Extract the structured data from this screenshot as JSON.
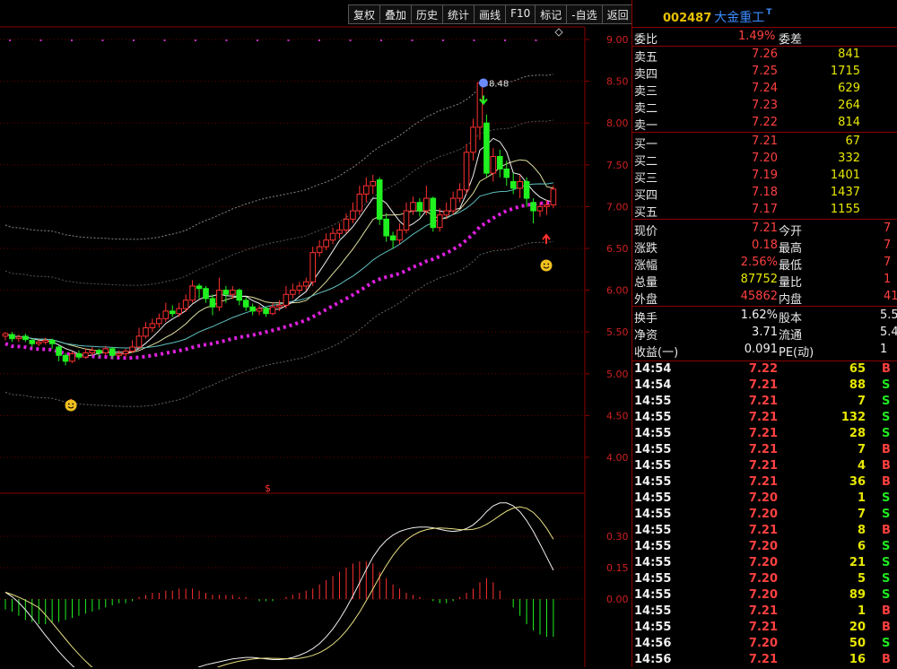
{
  "toolbar": [
    "复权",
    "叠加",
    "历史",
    "统计",
    "画线",
    "F10",
    "标记",
    "-自选",
    "返回"
  ],
  "stock": {
    "code": "002487",
    "name": "大金重工",
    "flag": "T"
  },
  "chart": {
    "price_ticks": [
      "9.00",
      "8.50",
      "8.00",
      "7.50",
      "7.00",
      "6.50",
      "6.00",
      "5.50",
      "5.00",
      "4.50",
      "4.00"
    ],
    "macd_ticks": [
      "0.30",
      "0.15",
      "0.00"
    ],
    "high_label": "8.48",
    "dollar_mark": "$"
  },
  "weibi": {
    "label": "委比",
    "value": "1.49%",
    "label2": "委差"
  },
  "asks": [
    {
      "label": "卖五",
      "price": "7.26",
      "vol": "841"
    },
    {
      "label": "卖四",
      "price": "7.25",
      "vol": "1715"
    },
    {
      "label": "卖三",
      "price": "7.24",
      "vol": "629"
    },
    {
      "label": "卖二",
      "price": "7.23",
      "vol": "264"
    },
    {
      "label": "卖一",
      "price": "7.22",
      "vol": "814"
    }
  ],
  "bids": [
    {
      "label": "买一",
      "price": "7.21",
      "vol": "67"
    },
    {
      "label": "买二",
      "price": "7.20",
      "vol": "332"
    },
    {
      "label": "买三",
      "price": "7.19",
      "vol": "1401"
    },
    {
      "label": "买四",
      "price": "7.18",
      "vol": "1437"
    },
    {
      "label": "买五",
      "price": "7.17",
      "vol": "1155"
    }
  ],
  "quote": [
    {
      "l1": "现价",
      "v1": "7.21",
      "c1": "red",
      "l2": "今开",
      "v2": "7"
    },
    {
      "l1": "涨跌",
      "v1": "0.18",
      "c1": "red",
      "l2": "最高",
      "v2": "7"
    },
    {
      "l1": "涨幅",
      "v1": "2.56%",
      "c1": "red",
      "l2": "最低",
      "v2": "7"
    },
    {
      "l1": "总量",
      "v1": "87752",
      "c1": "yel",
      "l2": "量比",
      "v2": "1"
    },
    {
      "l1": "外盘",
      "v1": "45862",
      "c1": "red",
      "l2": "内盘",
      "v2": "41"
    }
  ],
  "fin": [
    {
      "l1": "换手",
      "v1": "1.62%",
      "l2": "股本",
      "v2": "5.5"
    },
    {
      "l1": "净资",
      "v1": "3.71",
      "l2": "流通",
      "v2": "5.4"
    },
    {
      "l1": "收益(一)",
      "v1": "0.091",
      "l2": "PE(动)",
      "v2": "1"
    }
  ],
  "ticks": [
    {
      "t": "14:54",
      "p": "7.22",
      "v": "65",
      "s": "B"
    },
    {
      "t": "14:54",
      "p": "7.21",
      "v": "88",
      "s": "S"
    },
    {
      "t": "14:55",
      "p": "7.21",
      "v": "7",
      "s": "S"
    },
    {
      "t": "14:55",
      "p": "7.21",
      "v": "132",
      "s": "S"
    },
    {
      "t": "14:55",
      "p": "7.21",
      "v": "28",
      "s": "S"
    },
    {
      "t": "14:55",
      "p": "7.21",
      "v": "7",
      "s": "B"
    },
    {
      "t": "14:55",
      "p": "7.21",
      "v": "4",
      "s": "B"
    },
    {
      "t": "14:55",
      "p": "7.21",
      "v": "36",
      "s": "B"
    },
    {
      "t": "14:55",
      "p": "7.20",
      "v": "1",
      "s": "S"
    },
    {
      "t": "14:55",
      "p": "7.20",
      "v": "7",
      "s": "S"
    },
    {
      "t": "14:55",
      "p": "7.21",
      "v": "8",
      "s": "B"
    },
    {
      "t": "14:55",
      "p": "7.20",
      "v": "6",
      "s": "S"
    },
    {
      "t": "14:55",
      "p": "7.20",
      "v": "21",
      "s": "S"
    },
    {
      "t": "14:55",
      "p": "7.20",
      "v": "5",
      "s": "S"
    },
    {
      "t": "14:55",
      "p": "7.20",
      "v": "89",
      "s": "S"
    },
    {
      "t": "14:55",
      "p": "7.21",
      "v": "1",
      "s": "B"
    },
    {
      "t": "14:55",
      "p": "7.21",
      "v": "20",
      "s": "B"
    },
    {
      "t": "14:56",
      "p": "7.20",
      "v": "50",
      "s": "S"
    },
    {
      "t": "14:56",
      "p": "7.21",
      "v": "16",
      "s": "B"
    }
  ],
  "chart_data": {
    "type": "candlestick",
    "y_range": [
      3.6,
      9.2
    ],
    "candles": [
      [
        5.45,
        5.48,
        5.4,
        5.5
      ],
      [
        5.47,
        5.42,
        5.38,
        5.5
      ],
      [
        5.42,
        5.44,
        5.38,
        5.47
      ],
      [
        5.45,
        5.41,
        5.38,
        5.48
      ],
      [
        5.4,
        5.36,
        5.32,
        5.42
      ],
      [
        5.36,
        5.38,
        5.33,
        5.41
      ],
      [
        5.38,
        5.4,
        5.35,
        5.43
      ],
      [
        5.4,
        5.36,
        5.3,
        5.42
      ],
      [
        5.32,
        5.22,
        5.15,
        5.34
      ],
      [
        5.22,
        5.15,
        5.1,
        5.25
      ],
      [
        5.15,
        5.24,
        5.13,
        5.27
      ],
      [
        5.24,
        5.2,
        5.17,
        5.28
      ],
      [
        5.2,
        5.25,
        5.18,
        5.3
      ],
      [
        5.25,
        5.28,
        5.22,
        5.32
      ],
      [
        5.28,
        5.25,
        5.2,
        5.3
      ],
      [
        5.25,
        5.3,
        5.22,
        5.33
      ],
      [
        5.3,
        5.22,
        5.18,
        5.32
      ],
      [
        5.22,
        5.24,
        5.2,
        5.28
      ],
      [
        5.24,
        5.27,
        5.2,
        5.3
      ],
      [
        5.27,
        5.32,
        5.25,
        5.4
      ],
      [
        5.32,
        5.45,
        5.3,
        5.55
      ],
      [
        5.45,
        5.55,
        5.42,
        5.62
      ],
      [
        5.55,
        5.6,
        5.5,
        5.66
      ],
      [
        5.6,
        5.66,
        5.55,
        5.72
      ],
      [
        5.66,
        5.75,
        5.62,
        5.85
      ],
      [
        5.75,
        5.72,
        5.68,
        5.82
      ],
      [
        5.72,
        5.78,
        5.68,
        5.85
      ],
      [
        5.78,
        5.88,
        5.74,
        5.95
      ],
      [
        5.88,
        6.05,
        5.85,
        6.12
      ],
      [
        6.05,
        6.02,
        5.9,
        6.08
      ],
      [
        6.02,
        5.9,
        5.85,
        6.05
      ],
      [
        5.9,
        5.8,
        5.7,
        5.95
      ],
      [
        5.8,
        6.0,
        5.75,
        6.15
      ],
      [
        6.0,
        5.95,
        5.85,
        6.05
      ],
      [
        5.95,
        6.0,
        5.9,
        6.05
      ],
      [
        6.0,
        5.88,
        5.82,
        6.02
      ],
      [
        5.88,
        5.8,
        5.75,
        5.92
      ],
      [
        5.8,
        5.75,
        5.7,
        5.84
      ],
      [
        5.75,
        5.78,
        5.7,
        5.82
      ],
      [
        5.78,
        5.72,
        5.68,
        5.8
      ],
      [
        5.72,
        5.8,
        5.7,
        5.85
      ],
      [
        5.8,
        5.82,
        5.75,
        5.88
      ],
      [
        5.82,
        5.95,
        5.78,
        6.05
      ],
      [
        5.95,
        6.0,
        5.9,
        6.08
      ],
      [
        6.0,
        6.05,
        5.95,
        6.1
      ],
      [
        6.05,
        6.1,
        6.0,
        6.15
      ],
      [
        6.1,
        6.45,
        6.05,
        6.52
      ],
      [
        6.45,
        6.52,
        6.4,
        6.6
      ],
      [
        6.52,
        6.6,
        6.48,
        6.68
      ],
      [
        6.6,
        6.68,
        6.55,
        6.75
      ],
      [
        6.68,
        6.72,
        6.62,
        6.8
      ],
      [
        6.72,
        6.85,
        6.68,
        6.92
      ],
      [
        6.85,
        6.95,
        6.8,
        7.05
      ],
      [
        6.95,
        7.15,
        6.9,
        7.25
      ],
      [
        7.15,
        7.25,
        7.05,
        7.35
      ],
      [
        7.25,
        7.3,
        7.15,
        7.38
      ],
      [
        7.32,
        6.85,
        6.78,
        7.35
      ],
      [
        6.85,
        6.65,
        6.58,
        6.92
      ],
      [
        6.65,
        6.6,
        6.5,
        6.7
      ],
      [
        6.6,
        6.72,
        6.55,
        6.8
      ],
      [
        6.72,
        6.95,
        6.68,
        7.05
      ],
      [
        6.95,
        7.05,
        6.9,
        7.12
      ],
      [
        7.05,
        6.95,
        6.88,
        7.1
      ],
      [
        6.95,
        7.1,
        6.9,
        7.25
      ],
      [
        7.1,
        6.75,
        6.7,
        7.12
      ],
      [
        6.75,
        6.9,
        6.7,
        6.98
      ],
      [
        6.9,
        6.95,
        6.85,
        7.05
      ],
      [
        6.95,
        7.1,
        6.9,
        7.18
      ],
      [
        7.1,
        7.2,
        7.05,
        7.28
      ],
      [
        7.2,
        7.65,
        7.15,
        7.75
      ],
      [
        7.65,
        7.95,
        7.55,
        8.05
      ],
      [
        7.95,
        8.48,
        7.8,
        8.48
      ],
      [
        8.0,
        7.4,
        7.35,
        8.1
      ],
      [
        7.4,
        7.6,
        7.3,
        7.7
      ],
      [
        7.6,
        7.45,
        7.35,
        7.68
      ],
      [
        7.45,
        7.35,
        7.25,
        7.55
      ],
      [
        7.3,
        7.22,
        7.15,
        7.4
      ],
      [
        7.22,
        7.3,
        7.1,
        7.38
      ],
      [
        7.3,
        7.1,
        7.0,
        7.35
      ],
      [
        7.05,
        6.95,
        6.8,
        7.1
      ],
      [
        6.95,
        7.0,
        6.88,
        7.05
      ],
      [
        7.0,
        7.02,
        6.9,
        7.08
      ],
      [
        7.02,
        7.21,
        6.98,
        7.25
      ]
    ],
    "macd_range": [
      -0.26,
      0.52
    ],
    "macd_bars": [
      -0.05,
      -0.06,
      -0.08,
      -0.1,
      -0.11,
      -0.12,
      -0.12,
      -0.11,
      -0.11,
      -0.1,
      -0.09,
      -0.08,
      -0.07,
      -0.06,
      -0.05,
      -0.04,
      -0.03,
      -0.02,
      -0.02,
      -0.01,
      0.01,
      0.02,
      0.03,
      0.03,
      0.04,
      0.04,
      0.05,
      0.05,
      0.05,
      0.04,
      0.03,
      0.02,
      0.02,
      0.02,
      0.02,
      0.01,
      0.01,
      0.0,
      -0.01,
      -0.01,
      -0.01,
      0.0,
      0.01,
      0.02,
      0.03,
      0.04,
      0.05,
      0.07,
      0.09,
      0.11,
      0.13,
      0.15,
      0.17,
      0.18,
      0.18,
      0.17,
      0.13,
      0.1,
      0.07,
      0.05,
      0.03,
      0.02,
      0.01,
      0.0,
      -0.01,
      -0.02,
      -0.02,
      -0.01,
      0.01,
      0.03,
      0.05,
      0.08,
      0.1,
      0.08,
      0.04,
      0.0,
      -0.04,
      -0.08,
      -0.12,
      -0.15,
      -0.17,
      -0.18,
      -0.18
    ]
  }
}
